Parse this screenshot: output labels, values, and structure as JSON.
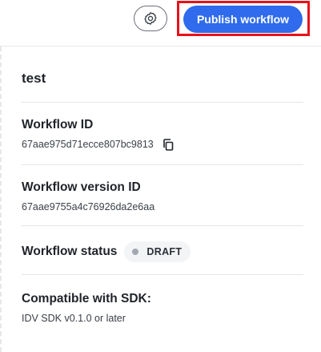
{
  "toolbar": {
    "settings_icon": "gear-icon",
    "publish_label": "Publish workflow",
    "accent_color": "#2f6bec",
    "highlight_color": "#e8121a"
  },
  "workflow": {
    "name": "test",
    "id_label": "Workflow ID",
    "id_value": "67aae975d71ecce807bc9813",
    "copy_icon": "copy-icon",
    "version_label": "Workflow version ID",
    "version_value": "67aae9755a4c76926da2e6aa",
    "status_label": "Workflow status",
    "status_value": "DRAFT",
    "sdk_label": "Compatible with SDK:",
    "sdk_value": "IDV SDK v0.1.0 or later"
  }
}
